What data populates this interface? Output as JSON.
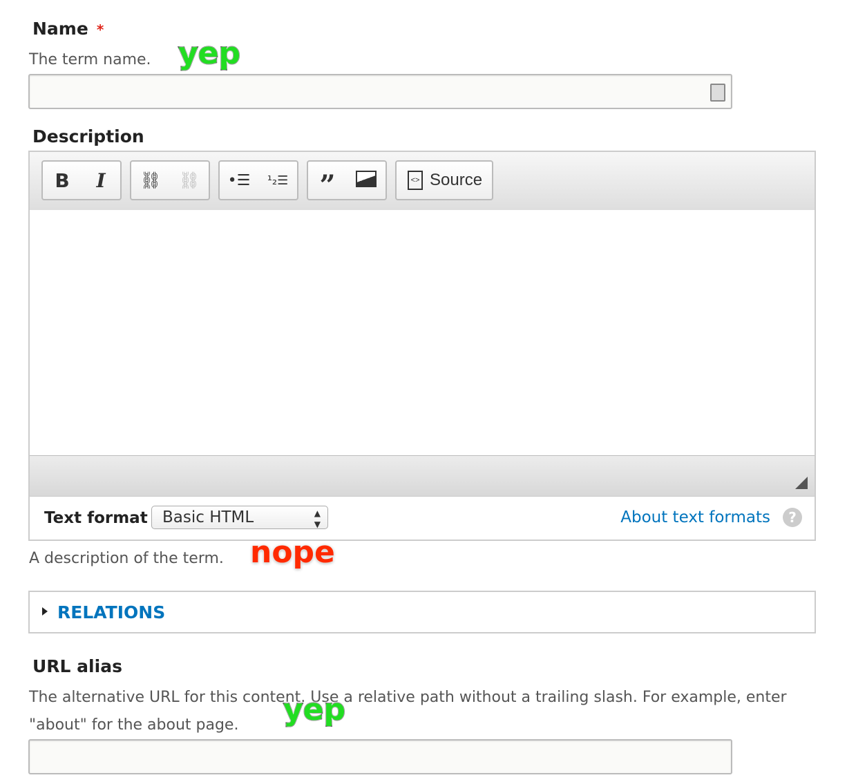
{
  "name_field": {
    "label": "Name",
    "required_marker": "*",
    "description": "The term name.",
    "value": ""
  },
  "description_field": {
    "label": "Description",
    "toolbar": {
      "bold": "B",
      "italic": "I",
      "link": "link-icon",
      "unlink": "unlink-icon",
      "bulleted_list": "bulleted-list-icon",
      "numbered_list": "numbered-list-icon",
      "blockquote": "blockquote-icon",
      "image": "image-icon",
      "source": "Source"
    },
    "text_format_label": "Text format",
    "text_format_value": "Basic HTML",
    "about_link": "About text formats",
    "help_icon": "?",
    "description": "A description of the term."
  },
  "relations": {
    "label": "RELATIONS"
  },
  "url_alias": {
    "label": "URL alias",
    "description_line1": "The alternative URL for this content. Use a relative path without a trailing slash. For example, enter",
    "description_line2": "\"about\" for the about page.",
    "value": ""
  },
  "annotations": {
    "a1": "yep",
    "a2": "nope",
    "a3": "yep"
  },
  "colors": {
    "link": "#0074bd",
    "required": "#e0251a",
    "yep": "#22dd22",
    "nope": "#ff2a00"
  }
}
